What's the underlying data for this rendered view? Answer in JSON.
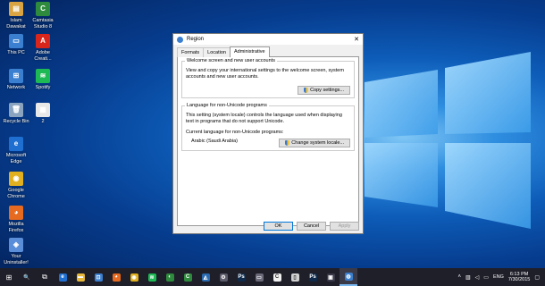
{
  "desktop_icons": [
    {
      "label": "Islam\nDawakat",
      "color": "#d9a441",
      "glyph": "▤"
    },
    {
      "label": "Camtasia\nStudio 8",
      "color": "#2e8b3d",
      "glyph": "C"
    },
    {
      "label": "This PC",
      "color": "#3a7fd0",
      "glyph": "▭"
    },
    {
      "label": "Adobe\nCreati...",
      "color": "#d8261c",
      "glyph": "A"
    },
    {
      "label": "Network",
      "color": "#3a7fd0",
      "glyph": "⊞"
    },
    {
      "label": "Spotify",
      "color": "#1db954",
      "glyph": "≋"
    },
    {
      "label": "Recycle Bin",
      "color": "#8aa4c0",
      "glyph": "🗑"
    },
    {
      "label": "2",
      "color": "#e8e8e8",
      "glyph": "▦"
    },
    {
      "label": "Microsoft\nEdge",
      "color": "#1f6fd0",
      "glyph": "e"
    },
    {
      "label": "Google\nChrome",
      "color": "#e0b020",
      "glyph": "◉"
    },
    {
      "label": "Mozilla\nFirefox",
      "color": "#e66a1f",
      "glyph": "◕"
    },
    {
      "label": "Your\nUninstaller!",
      "color": "#5a8ed8",
      "glyph": "◈"
    }
  ],
  "dialog": {
    "title": "Region",
    "close": "✕",
    "tabs": [
      "Formats",
      "Location",
      "Administrative"
    ],
    "welcome_group": {
      "title": "Welcome screen and new user accounts",
      "desc": "View and copy your international settings to the welcome screen, system accounts and new user accounts.",
      "button": "Copy settings..."
    },
    "unicode_group": {
      "title": "Language for non-Unicode programs",
      "desc": "This setting (system locale) controls the language used when displaying text in programs that do not support Unicode.",
      "current_label": "Current language for non-Unicode programs:",
      "current_value": "Arabic (Saudi Arabia)",
      "button": "Change system locale..."
    },
    "ok": "OK",
    "cancel": "Cancel",
    "apply": "Apply"
  },
  "taskbar": {
    "start": "⊞",
    "search": "🔍",
    "task_view": "⧉",
    "apps": [
      {
        "name": "edge",
        "color": "#1f6fd0",
        "glyph": "e"
      },
      {
        "name": "file-explorer",
        "color": "#e8b83a",
        "glyph": "▬"
      },
      {
        "name": "store",
        "color": "#3a7fd0",
        "glyph": "⊡"
      },
      {
        "name": "firefox",
        "color": "#e66a1f",
        "glyph": "◕"
      },
      {
        "name": "chrome",
        "color": "#e0b020",
        "glyph": "◉"
      },
      {
        "name": "spotify",
        "color": "#1db954",
        "glyph": "≋"
      },
      {
        "name": "app-green",
        "color": "#2e8b3d",
        "glyph": "◐"
      },
      {
        "name": "camtasia",
        "color": "#2e8b3d",
        "glyph": "C"
      },
      {
        "name": "app-blue",
        "color": "#2a6ab0",
        "glyph": "◭"
      },
      {
        "name": "settings",
        "color": "#5a5a6a",
        "glyph": "⚙"
      },
      {
        "name": "photoshop",
        "color": "#0f2a4a",
        "glyph": "Ps"
      },
      {
        "name": "app-gray",
        "color": "#6a6a7a",
        "glyph": "▭"
      },
      {
        "name": "camtasia-recorder",
        "color": "#f0f0f0",
        "glyph": "C"
      },
      {
        "name": "app-light",
        "color": "#d0d0d0",
        "glyph": "▯"
      },
      {
        "name": "photoshop-2",
        "color": "#0f2a4a",
        "glyph": "Ps"
      },
      {
        "name": "app-dark",
        "color": "#3a3a4a",
        "glyph": "▣"
      },
      {
        "name": "region",
        "color": "#3a7fd0",
        "glyph": "◍"
      }
    ],
    "tray": {
      "language": "ENG",
      "time": "6:13 PM",
      "date": "7/30/2015"
    }
  }
}
